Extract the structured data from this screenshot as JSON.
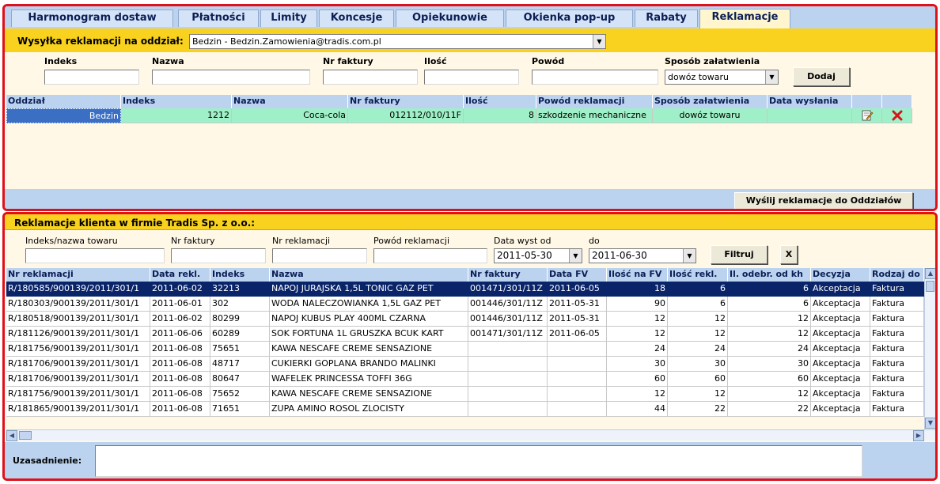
{
  "tabs": [
    "Harmonogram dostaw",
    "Płatności",
    "Limity",
    "Koncesje",
    "Opiekunowie",
    "Okienka pop-up",
    "Rabaty",
    "Reklamacje"
  ],
  "active_tab": "Reklamacje",
  "send_section": {
    "label": "Wysyłka reklamacji na oddział:",
    "branch_value": "Bedzin  -  Bedzin.Zamowienia@tradis.com.pl"
  },
  "entry_form": {
    "indeks_label": "Indeks",
    "nazwa_label": "Nazwa",
    "faktura_label": "Nr faktury",
    "ilosc_label": "Ilość",
    "powod_label": "Powód",
    "sposob_label": "Sposób załatwienia",
    "sposob_value": "dowóz towaru",
    "add_button": "Dodaj"
  },
  "top_grid": {
    "headers": [
      "Oddział",
      "Indeks",
      "Nazwa",
      "Nr faktury",
      "Ilość",
      "Powód reklamacji",
      "Sposób załatwienia",
      "Data wysłania"
    ],
    "row": {
      "oddzial": "Bedzin",
      "indeks": "1212",
      "nazwa": "Coca-cola",
      "faktura": "012112/010/11F",
      "ilosc": "8",
      "powod": "szkodzenie mechaniczne",
      "sposob": "dowóz towaru",
      "data": ""
    }
  },
  "send_button": "Wyślij reklamacje do Oddziałów",
  "client_section": {
    "title": "Reklamacje klienta w firmie Tradis Sp. z o.o.:",
    "filter_indeks_label": "Indeks/nazwa towaru",
    "filter_faktura_label": "Nr faktury",
    "filter_reklamacja_label": "Nr reklamacji",
    "filter_powod_label": "Powód reklamacji",
    "date_from_label": "Data wyst od",
    "date_from": "2011-05-30",
    "date_to_label": "do",
    "date_to": "2011-06-30",
    "filter_button": "Filtruj",
    "clear_button": "X"
  },
  "bottom_grid": {
    "headers": [
      "Nr reklamacji",
      "Data rekl.",
      "Indeks",
      "Nazwa",
      "Nr faktury",
      "Data FV",
      "Ilość na FV",
      "Ilość rekl.",
      "Il. odebr. od kh",
      "Decyzja",
      "Rodzaj do"
    ],
    "rows": [
      [
        "R/180585/900139/2011/301/1",
        "2011-06-02",
        "32213",
        "NAPOJ JURAJSKA 1,5L TONIC GAZ PET",
        "001471/301/11Z",
        "2011-06-05",
        "18",
        "6",
        "6",
        "Akceptacja",
        "Faktura"
      ],
      [
        "R/180303/900139/2011/301/1",
        "2011-06-01",
        "302",
        "WODA NALECZOWIANKA 1,5L GAZ PET",
        "001446/301/11Z",
        "2011-05-31",
        "90",
        "6",
        "6",
        "Akceptacja",
        "Faktura"
      ],
      [
        "R/180518/900139/2011/301/1",
        "2011-06-02",
        "80299",
        "NAPOJ KUBUS PLAY 400ML CZARNA",
        "001446/301/11Z",
        "2011-05-31",
        "12",
        "12",
        "12",
        "Akceptacja",
        "Faktura"
      ],
      [
        "R/181126/900139/2011/301/1",
        "2011-06-06",
        "60289",
        "SOK FORTUNA 1L GRUSZKA BCUK KART",
        "001471/301/11Z",
        "2011-06-05",
        "12",
        "12",
        "12",
        "Akceptacja",
        "Faktura"
      ],
      [
        "R/181756/900139/2011/301/1",
        "2011-06-08",
        "75651",
        "KAWA NESCAFE CREME SENSAZIONE",
        "",
        "",
        "24",
        "24",
        "24",
        "Akceptacja",
        "Faktura"
      ],
      [
        "R/181706/900139/2011/301/1",
        "2011-06-08",
        "48717",
        "CUKIERKI GOPLANA BRANDO MALINKI",
        "",
        "",
        "30",
        "30",
        "30",
        "Akceptacja",
        "Faktura"
      ],
      [
        "R/181706/900139/2011/301/1",
        "2011-06-08",
        "80647",
        "WAFELEK PRINCESSA TOFFI 36G",
        "",
        "",
        "60",
        "60",
        "60",
        "Akceptacja",
        "Faktura"
      ],
      [
        "R/181756/900139/2011/301/1",
        "2011-06-08",
        "75652",
        "KAWA NESCAFE CREME SENSAZIONE",
        "",
        "",
        "12",
        "12",
        "12",
        "Akceptacja",
        "Faktura"
      ],
      [
        "R/181865/900139/2011/301/1",
        "2011-06-08",
        "71651",
        "ZUPA AMINO ROSOL ZLOCISTY",
        "",
        "",
        "44",
        "22",
        "22",
        "Akceptacja",
        "Faktura"
      ]
    ]
  },
  "justification_label": "Uzasadnienie:",
  "colors": {
    "frame": "#e0101a",
    "yellow": "#f8d21e",
    "header_blue": "#bcd3f0",
    "row_green": "#9ff0c8",
    "selection": "#0a246a"
  }
}
